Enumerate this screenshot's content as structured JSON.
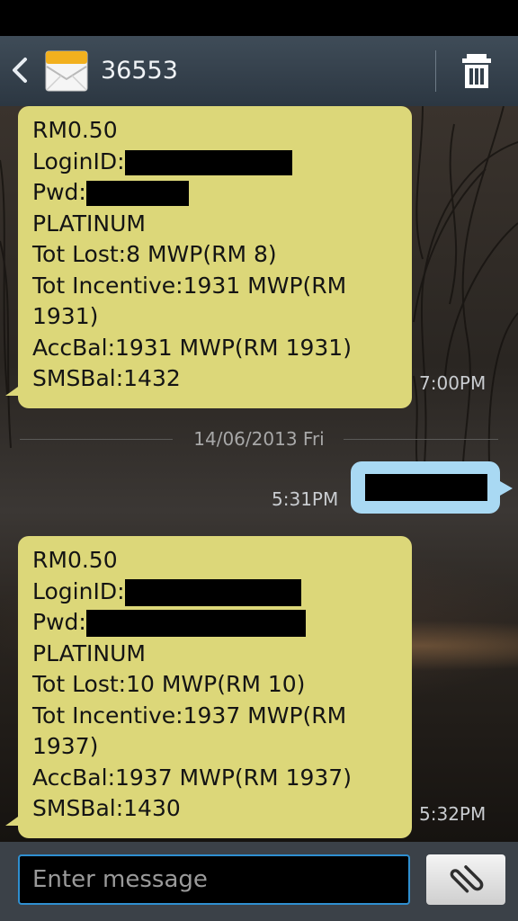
{
  "header": {
    "contact": "36553",
    "back_icon": "back-arrow-icon",
    "app_icon": "message-envelope-icon",
    "delete_icon": "trash-icon"
  },
  "messages": [
    {
      "direction": "incoming",
      "lines": [
        "RM0.50",
        "LoginID:",
        "Pwd:",
        "PLATINUM",
        "Tot Lost:8 MWP(RM 8)",
        "Tot Incentive:1931 MWP(RM",
        "1931)",
        "AccBal:1931 MWP(RM 1931)",
        "SMSBal:1432"
      ],
      "time": "7:00PM"
    },
    {
      "direction": "outgoing",
      "text_redacted": true,
      "time": "5:31PM"
    },
    {
      "direction": "incoming",
      "lines": [
        "RM0.50",
        "LoginID:",
        "Pwd:",
        "PLATINUM",
        "Tot Lost:10 MWP(RM 10)",
        "Tot Incentive:1937 MWP(RM",
        "1937)",
        "AccBal:1937 MWP(RM 1937)",
        "SMSBal:1430"
      ],
      "time": "5:32PM"
    }
  ],
  "date_separator": "14/06/2013 Fri",
  "composer": {
    "placeholder": "Enter message",
    "attach_icon": "paperclip-icon"
  },
  "colors": {
    "incoming_bubble": "#dcd779",
    "outgoing_bubble": "#a9d9f3",
    "header": "#34404b",
    "input_border": "#2f8fd0"
  }
}
